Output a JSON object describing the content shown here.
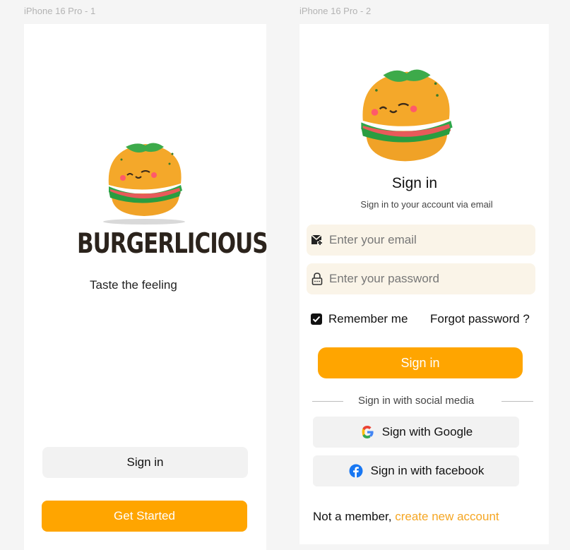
{
  "frames": {
    "frame1_label": "iPhone 16 Pro - 1",
    "frame2_label": "iPhone 16 Pro - 2"
  },
  "screen1": {
    "brand": "BURGERLICIOUS",
    "tagline": "Taste the feeling",
    "signin_label": "Sign in",
    "get_started_label": "Get Started"
  },
  "screen2": {
    "title": "Sign in",
    "subtitle": "Sign in to your account via email",
    "email_placeholder": "Enter your email",
    "password_placeholder": "Enter your password",
    "remember_label": "Remember me",
    "forgot_label": "Forgot password ?",
    "signin_label": "Sign in",
    "social_divider": "Sign in with social media",
    "google_label": "Sign with Google",
    "facebook_label": "Sign in with facebook",
    "footer_text": "Not a member, ",
    "footer_link": "create new account"
  },
  "colors": {
    "accent": "#ffa500",
    "button_grey": "#f2f2f2",
    "input_bg": "#faf4e8",
    "link": "#f5a623"
  },
  "icons": {
    "email": "mail-plus-icon",
    "password": "lock-icon",
    "checkbox": "checkbox-checked-icon",
    "google": "google-icon",
    "facebook": "facebook-icon",
    "logo": "burger-mascot-icon"
  }
}
